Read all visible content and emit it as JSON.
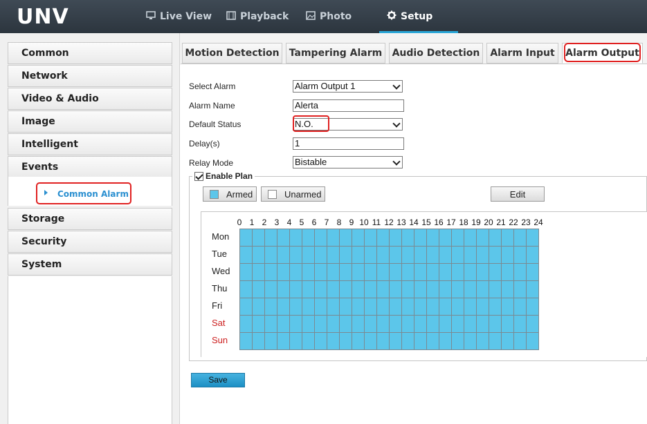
{
  "header": {
    "logo": "UNV",
    "nav": [
      {
        "label": "Live View",
        "icon": "monitor-icon"
      },
      {
        "label": "Playback",
        "icon": "film-icon"
      },
      {
        "label": "Photo",
        "icon": "picture-icon"
      },
      {
        "label": "Setup",
        "icon": "gear-icon",
        "active": true
      }
    ]
  },
  "sidebar": {
    "items": [
      {
        "label": "Common"
      },
      {
        "label": "Network"
      },
      {
        "label": "Video & Audio"
      },
      {
        "label": "Image"
      },
      {
        "label": "Intelligent"
      },
      {
        "label": "Events"
      },
      {
        "label": "Storage"
      },
      {
        "label": "Security"
      },
      {
        "label": "System"
      }
    ],
    "submenu": {
      "label": "Common Alarm"
    }
  },
  "tabs": [
    {
      "label": "Motion Detection"
    },
    {
      "label": "Tampering Alarm"
    },
    {
      "label": "Audio Detection"
    },
    {
      "label": "Alarm Input"
    },
    {
      "label": "Alarm Output",
      "active": true
    }
  ],
  "form": {
    "select_alarm": {
      "label": "Select Alarm",
      "value": "Alarm Output 1"
    },
    "alarm_name": {
      "label": "Alarm Name",
      "value": "Alerta"
    },
    "default_status": {
      "label": "Default Status",
      "value": "N.O."
    },
    "delay": {
      "label": "Delay(s)",
      "value": "1"
    },
    "relay_mode": {
      "label": "Relay Mode",
      "value": "Bistable"
    }
  },
  "plan": {
    "enable_label": "Enable Plan",
    "enabled": true,
    "armed_label": "Armed",
    "unarmed_label": "Unarmed",
    "edit_label": "Edit",
    "hours": [
      "0",
      "1",
      "2",
      "3",
      "4",
      "5",
      "6",
      "7",
      "8",
      "9",
      "10",
      "11",
      "12",
      "13",
      "14",
      "15",
      "16",
      "17",
      "18",
      "19",
      "20",
      "21",
      "22",
      "23",
      "24"
    ],
    "days": [
      "Mon",
      "Tue",
      "Wed",
      "Thu",
      "Fri",
      "Sat",
      "Sun"
    ],
    "armed_color": "#5cc6ea",
    "weekend_color": "#cc1f1f"
  },
  "save_label": "Save",
  "colors": {
    "highlight": "#e02020",
    "accent": "#2aa7d8"
  }
}
